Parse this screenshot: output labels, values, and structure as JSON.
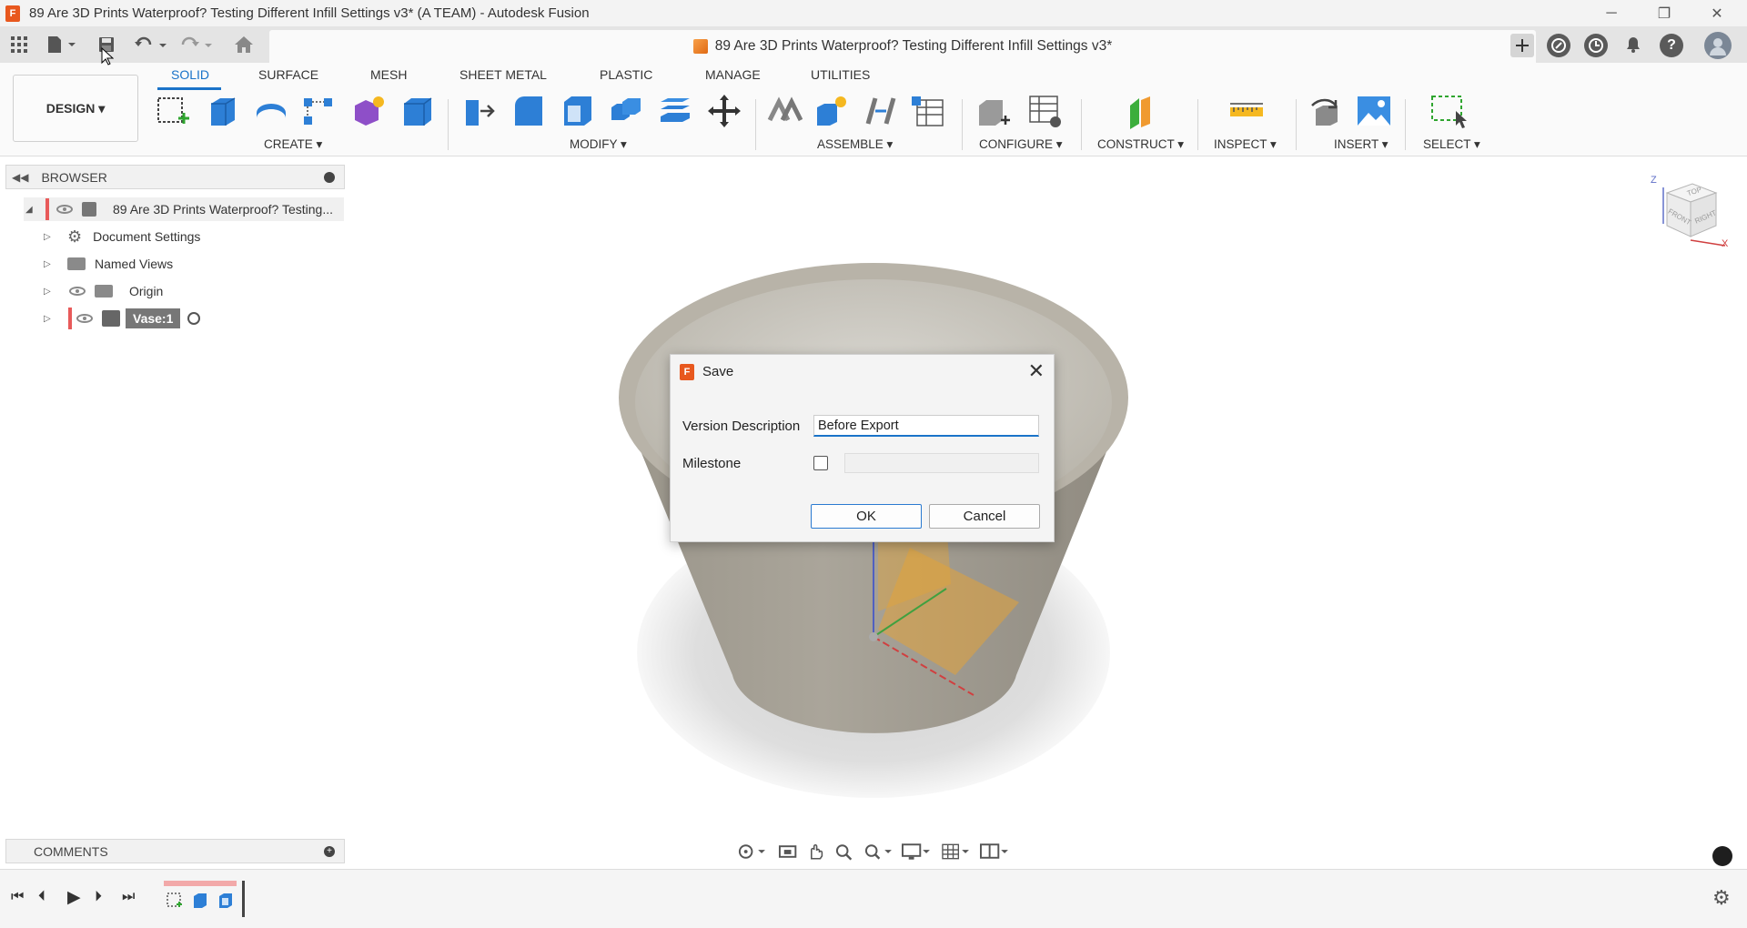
{
  "window": {
    "title": "89 Are 3D Prints Waterproof? Testing Different Infill Settings v3* (A TEAM) - Autodesk Fusion",
    "app_logo": "F",
    "minimize": "─",
    "restore": "❐",
    "close": "✕"
  },
  "tab": {
    "title": "89 Are 3D Prints Waterproof? Testing Different Infill Settings v3*",
    "close": "✕"
  },
  "ribbon": {
    "workspace": "DESIGN ▾",
    "tabs": [
      "SOLID",
      "SURFACE",
      "MESH",
      "SHEET METAL",
      "PLASTIC",
      "MANAGE",
      "UTILITIES"
    ],
    "groups": [
      "CREATE ▾",
      "MODIFY ▾",
      "ASSEMBLE ▾",
      "CONFIGURE ▾",
      "CONSTRUCT ▾",
      "INSPECT ▾",
      "INSERT ▾",
      "SELECT ▾"
    ]
  },
  "browser": {
    "title": "BROWSER",
    "collapse": "◀◀",
    "root": "89 Are 3D Prints Waterproof? Testing...",
    "items": [
      "Document Settings",
      "Named Views",
      "Origin",
      "Vase:1"
    ]
  },
  "comments": {
    "title": "COMMENTS",
    "add": "+"
  },
  "dialog": {
    "logo": "F",
    "title": "Save",
    "close": "✕",
    "version_label": "Version Description",
    "version_value": "Before Export",
    "milestone_label": "Milestone",
    "milestone_checked": false,
    "ok_label": "OK",
    "cancel_label": "Cancel"
  },
  "viewcube": {
    "top": "TOP",
    "front": "FRONT",
    "right": "RIGHT",
    "axis_z": "Z",
    "axis_x": "X"
  },
  "colors": {
    "accent": "#1a73c9",
    "fusion_orange": "#e8581e"
  },
  "icons": {
    "apps": "apps-grid-icon",
    "file": "file-icon",
    "save": "save-icon",
    "undo": "undo-icon",
    "redo": "redo-icon",
    "home": "home-icon",
    "settings": "gear-icon"
  }
}
